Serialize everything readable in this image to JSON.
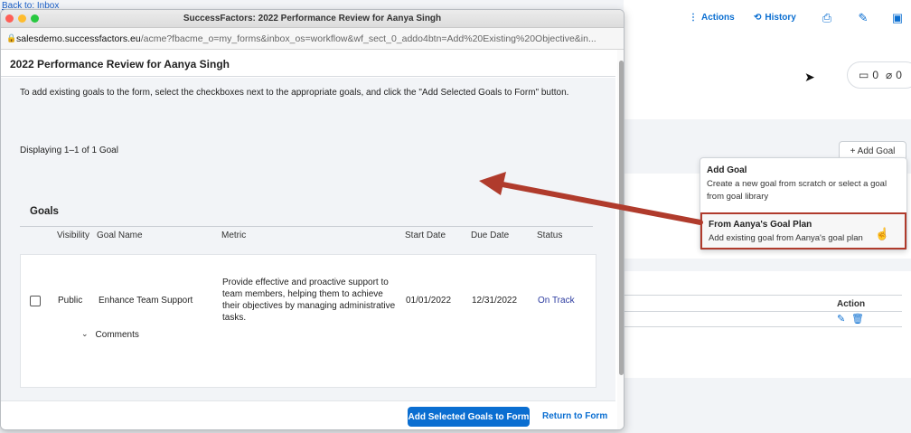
{
  "background": {
    "back_link": "Back to: Inbox",
    "toolbar": {
      "actions": "Actions",
      "history": "History"
    },
    "counters": {
      "comments": "0",
      "attachments": "0"
    },
    "add_goal_button": "+ Add Goal",
    "table": {
      "action_header": "Action"
    }
  },
  "menu": {
    "items": [
      {
        "title": "Add Goal",
        "description": "Create a new goal from scratch or select a goal from goal library"
      },
      {
        "title": "From Aanya's Goal Plan",
        "description": "Add existing goal from Aanya's goal plan"
      }
    ]
  },
  "popup": {
    "window_title": "SuccessFactors: 2022 Performance Review for Aanya Singh",
    "url_host": "salesdemo.successfactors.eu",
    "url_path": "/acme?fbacme_o=my_forms&inbox_os=workflow&wf_sect_0_addo4btn=Add%20Existing%20Objective&in...",
    "page_title": "2022 Performance Review for Aanya Singh",
    "instructions": "To add existing goals to the form, select the checkboxes next to the appropriate goals, and click the \"Add Selected Goals to Form\" button.",
    "displaying": "Displaying 1–1 of 1 Goal",
    "goals_title": "Goals",
    "columns": [
      "Visibility",
      "Goal Name",
      "Metric",
      "Start Date",
      "Due Date",
      "Status"
    ],
    "rows": [
      {
        "visibility": "Public",
        "goal_name": "Enhance Team Support",
        "metric": "Provide effective and proactive support to team members, helping them to achieve their objectives by managing administrative tasks.",
        "start_date": "01/01/2022",
        "due_date": "12/31/2022",
        "status": "On Track"
      }
    ],
    "comments_label": "Comments",
    "footer": {
      "add_selected": "Add Selected Goals to Form",
      "return_to_form": "Return to Form"
    }
  },
  "colors": {
    "primary": "#0a6ed1",
    "highlight_border": "#b03b2c",
    "arrow": "#b03b2c"
  }
}
